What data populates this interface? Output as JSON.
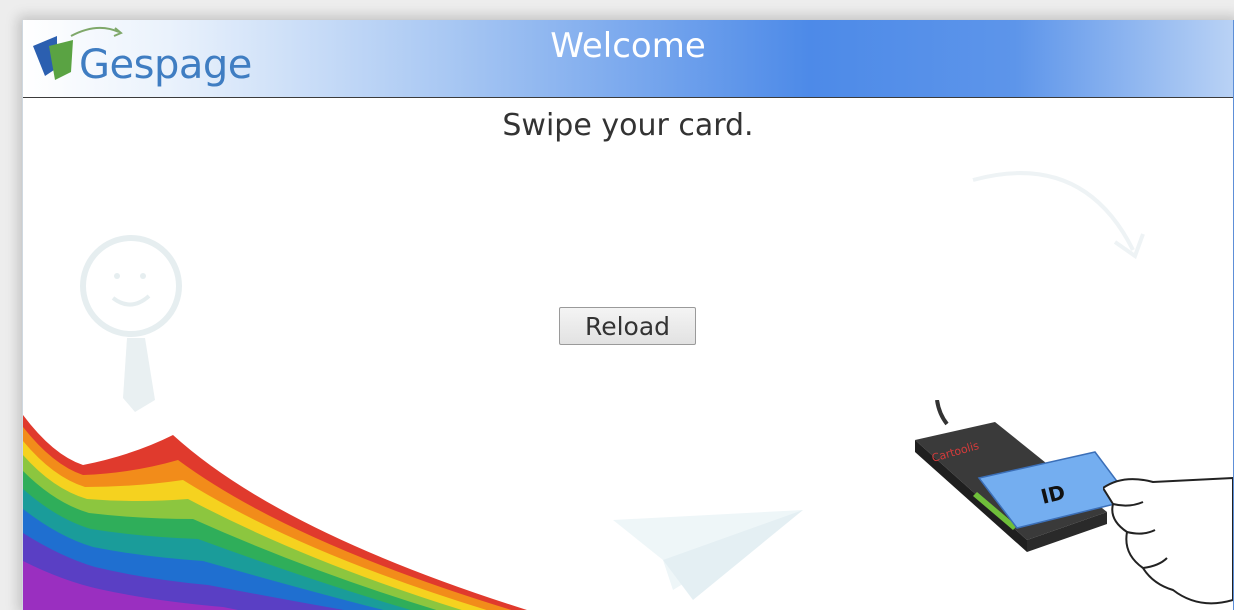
{
  "header": {
    "logo_text": "Gespage",
    "title": "Welcome"
  },
  "main": {
    "instruction": "Swipe your card.",
    "reload_label": "Reload"
  },
  "illustration": {
    "reader_brand": "Cartoolis",
    "card_label": "ID"
  },
  "colors": {
    "header_accent": "#4d8ae8",
    "logo_blue": "#3f7dc2",
    "card_blue": "#74aef0",
    "text": "#333333"
  },
  "icons": [
    "logo-leaf-icon",
    "smiley-person-icon",
    "paper-plane-icon",
    "curved-arrow-icon",
    "card-reader-icon",
    "hand-icon"
  ]
}
